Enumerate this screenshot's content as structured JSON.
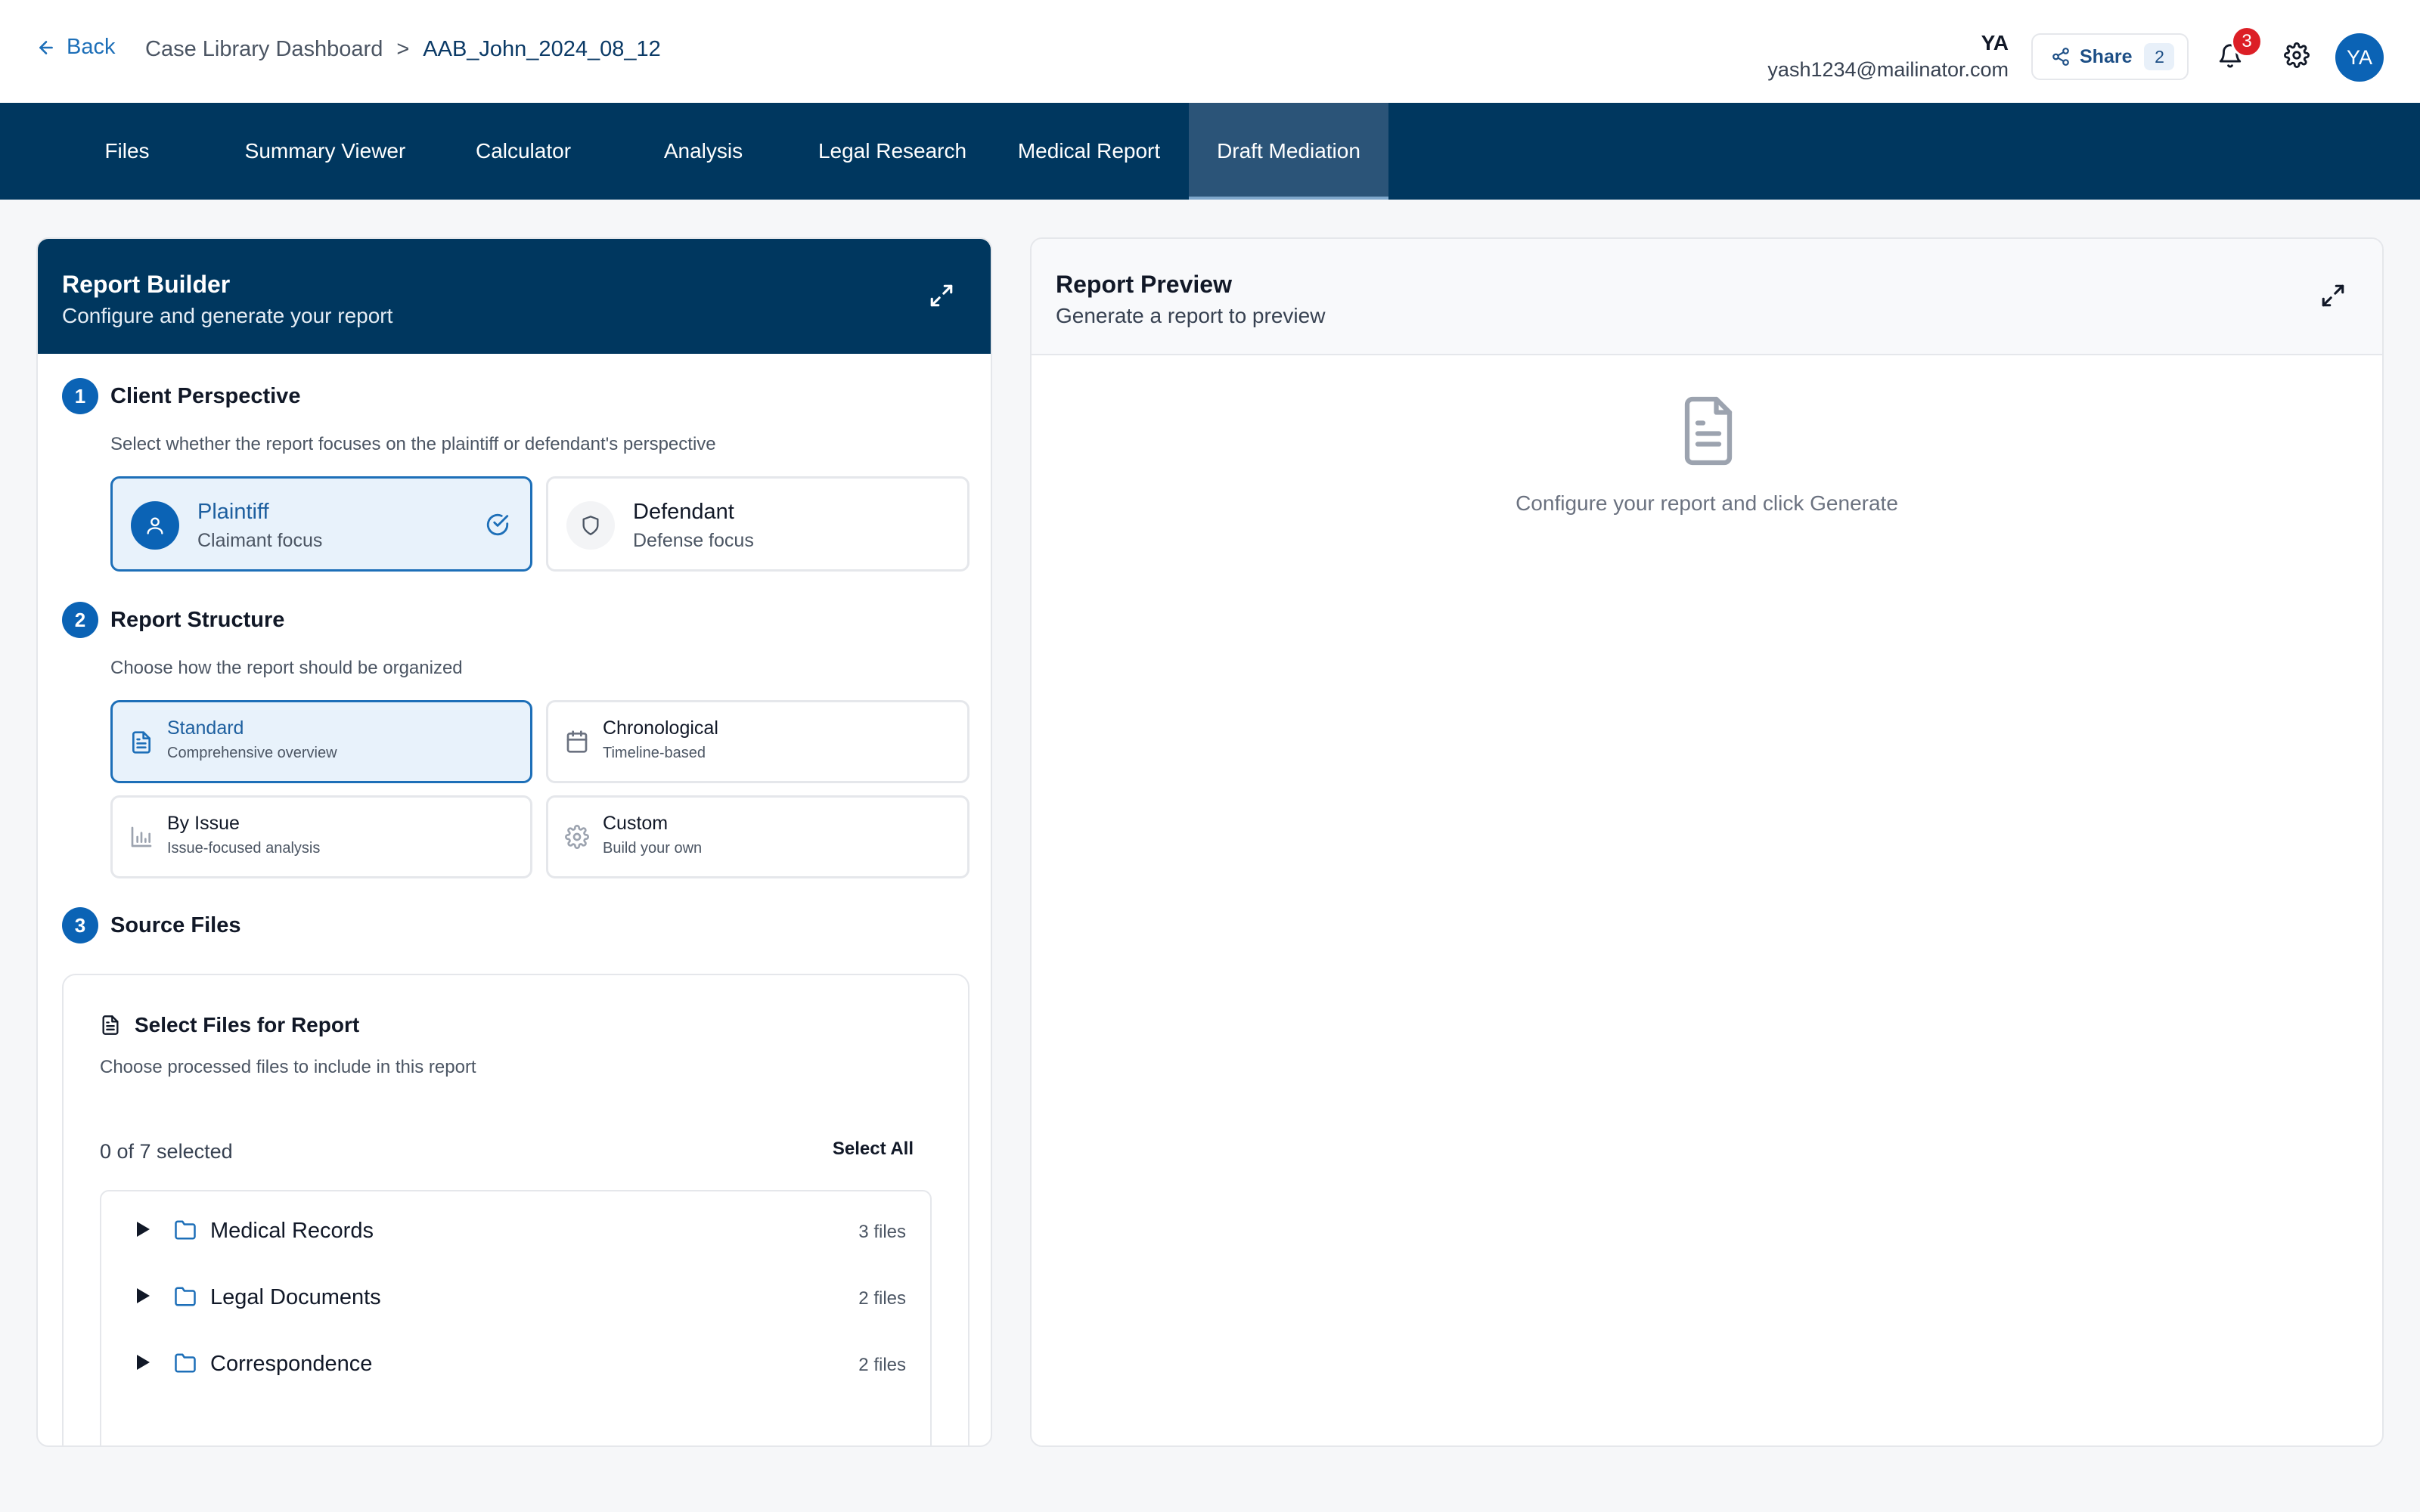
{
  "header": {
    "back_label": "Back",
    "breadcrumb": {
      "parent": "Case Library Dashboard",
      "separator": ">",
      "current": "AAB_John_2024_08_12"
    },
    "user": {
      "initials": "YA",
      "email": "yash1234@mailinator.com"
    },
    "share": {
      "label": "Share",
      "count": "2"
    },
    "notifications": {
      "count": "3"
    },
    "avatar_initials": "YA"
  },
  "nav": {
    "tabs": [
      {
        "label": "Files"
      },
      {
        "label": "Summary Viewer"
      },
      {
        "label": "Calculator"
      },
      {
        "label": "Analysis"
      },
      {
        "label": "Legal Research"
      },
      {
        "label": "Medical Report"
      },
      {
        "label": "Draft Mediation"
      }
    ],
    "active_tab": "Draft Mediation"
  },
  "report_builder": {
    "title": "Report Builder",
    "subtitle": "Configure and generate your report",
    "step1": {
      "number": "1",
      "title": "Client Perspective",
      "description": "Select whether the report focuses on the plaintiff or defendant's perspective",
      "options": [
        {
          "title": "Plaintiff",
          "subtitle": "Claimant focus",
          "selected": true
        },
        {
          "title": "Defendant",
          "subtitle": "Defense focus",
          "selected": false
        }
      ]
    },
    "step2": {
      "number": "2",
      "title": "Report Structure",
      "description": "Choose how the report should be organized",
      "options": [
        {
          "title": "Standard",
          "subtitle": "Comprehensive overview",
          "icon": "document-icon",
          "selected": true
        },
        {
          "title": "Chronological",
          "subtitle": "Timeline-based",
          "icon": "calendar-icon",
          "selected": false
        },
        {
          "title": "By Issue",
          "subtitle": "Issue-focused analysis",
          "icon": "bar-chart-icon",
          "selected": false
        },
        {
          "title": "Custom",
          "subtitle": "Build your own",
          "icon": "gear-icon",
          "selected": false
        }
      ]
    },
    "step3": {
      "number": "3",
      "title": "Source Files",
      "box_title": "Select Files for Report",
      "box_description": "Choose processed files to include in this report",
      "selected_count": "0 of 7 selected",
      "select_all_label": "Select All",
      "folders": [
        {
          "name": "Medical Records",
          "count": "3 files"
        },
        {
          "name": "Legal Documents",
          "count": "2 files"
        },
        {
          "name": "Correspondence",
          "count": "2 files"
        }
      ]
    }
  },
  "report_preview": {
    "title": "Report Preview",
    "subtitle": "Generate a report to preview",
    "empty_message": "Configure your report and click Generate"
  },
  "colors": {
    "navy": "#00375f",
    "accent_blue": "#0b63b5",
    "link_blue": "#1d6fb8",
    "selected_bg": "#e8f2fb",
    "badge_red": "#dc1f26"
  }
}
